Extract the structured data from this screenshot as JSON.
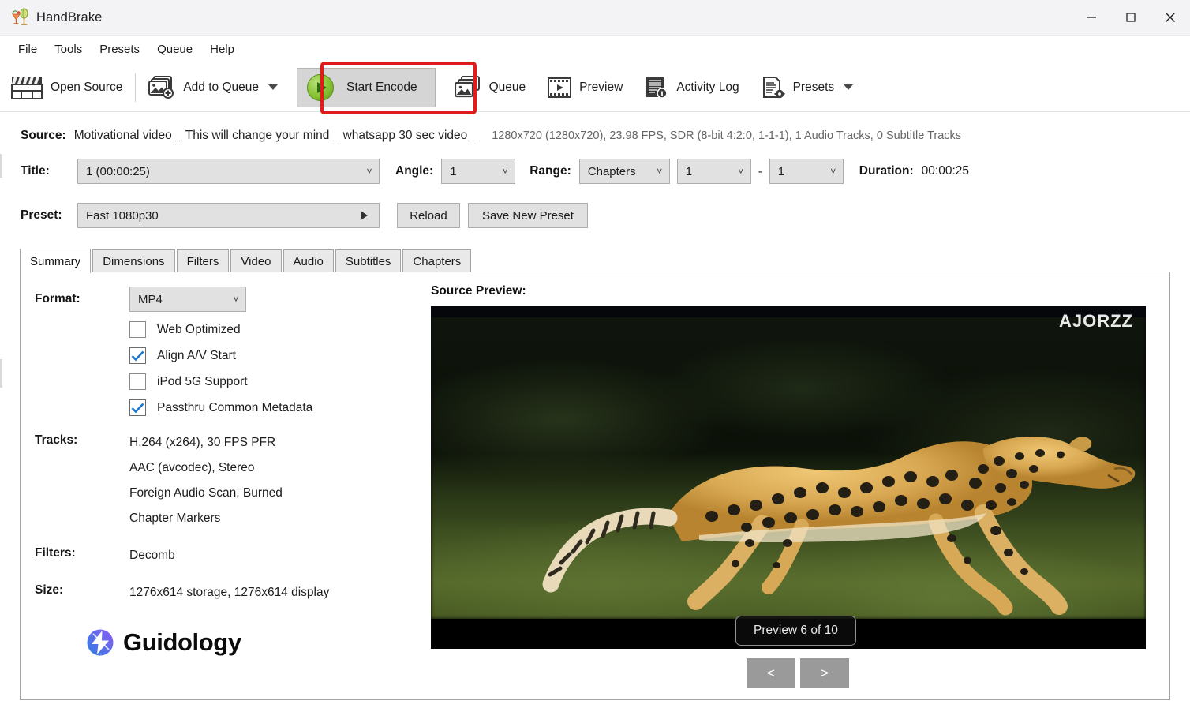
{
  "window": {
    "title": "HandBrake",
    "app_icon": "handbrake-cocktail-icon",
    "minimize": "minimize-icon",
    "maximize": "maximize-icon",
    "close": "close-icon"
  },
  "menu": {
    "items": [
      {
        "label": "File"
      },
      {
        "label": "Tools"
      },
      {
        "label": "Presets"
      },
      {
        "label": "Queue"
      },
      {
        "label": "Help"
      }
    ]
  },
  "toolbar": {
    "open_source": "Open Source",
    "add_to_queue": "Add to Queue",
    "start_encode": "Start Encode",
    "queue": "Queue",
    "preview": "Preview",
    "activity_log": "Activity Log",
    "presets": "Presets",
    "highlight_color": "#e01b1b",
    "start_encode_play_color": "#86c232"
  },
  "source": {
    "label": "Source:",
    "name": "Motivational video _ This will change your mind _ whatsapp 30 sec video _",
    "meta": "1280x720 (1280x720), 23.98 FPS, SDR (8-bit 4:2:0, 1-1-1), 1 Audio Tracks, 0 Subtitle Tracks"
  },
  "title_row": {
    "title_label": "Title:",
    "title_value": "1  (00:00:25)",
    "angle_label": "Angle:",
    "angle_value": "1",
    "range_label": "Range:",
    "range_type": "Chapters",
    "range_start": "1",
    "range_dash": "-",
    "range_end": "1",
    "duration_label": "Duration:",
    "duration_value": "00:00:25"
  },
  "preset_row": {
    "label": "Preset:",
    "value": "Fast 1080p30",
    "reload": "Reload",
    "save_new_preset": "Save New Preset"
  },
  "tabs": [
    {
      "label": "Summary",
      "active": true
    },
    {
      "label": "Dimensions",
      "active": false
    },
    {
      "label": "Filters",
      "active": false
    },
    {
      "label": "Video",
      "active": false
    },
    {
      "label": "Audio",
      "active": false
    },
    {
      "label": "Subtitles",
      "active": false
    },
    {
      "label": "Chapters",
      "active": false
    }
  ],
  "summary": {
    "format_label": "Format:",
    "format_value": "MP4",
    "checkboxes": [
      {
        "label": "Web Optimized",
        "checked": false
      },
      {
        "label": "Align A/V Start",
        "checked": true
      },
      {
        "label": "iPod 5G Support",
        "checked": false
      },
      {
        "label": "Passthru Common Metadata",
        "checked": true
      }
    ],
    "tracks_label": "Tracks:",
    "tracks": [
      "H.264 (x264), 30 FPS PFR",
      "AAC (avcodec), Stereo",
      "Foreign Audio Scan, Burned",
      "Chapter Markers"
    ],
    "filters_label": "Filters:",
    "filters_value": "Decomb",
    "size_label": "Size:",
    "size_value": "1276x614 storage, 1276x614 display"
  },
  "logo": {
    "text": "Guidology",
    "gradient_from": "#2f7fe0",
    "gradient_to": "#8b5cf6"
  },
  "preview": {
    "title": "Source Preview:",
    "watermark": "AJORZZ",
    "badge": "Preview 6 of 10",
    "prev_button": "<",
    "next_button": ">"
  }
}
